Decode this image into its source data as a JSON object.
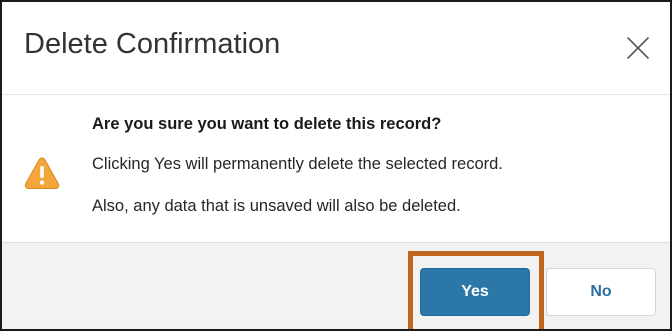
{
  "dialog": {
    "title": "Delete Confirmation",
    "close_icon": "close-icon",
    "heading": "Are you sure you want to delete this record?",
    "line1": "Clicking Yes will permanently delete the selected record.",
    "line2": "Also, any data that is unsaved will also be deleted.",
    "warning_icon": "warning-triangle-icon",
    "yes_label": "Yes",
    "no_label": "No"
  },
  "colors": {
    "primary_button": "#2b78a8",
    "highlight_border": "#c0651e",
    "warning": "#f3a73b",
    "footer_bg": "#f2f2f2"
  }
}
